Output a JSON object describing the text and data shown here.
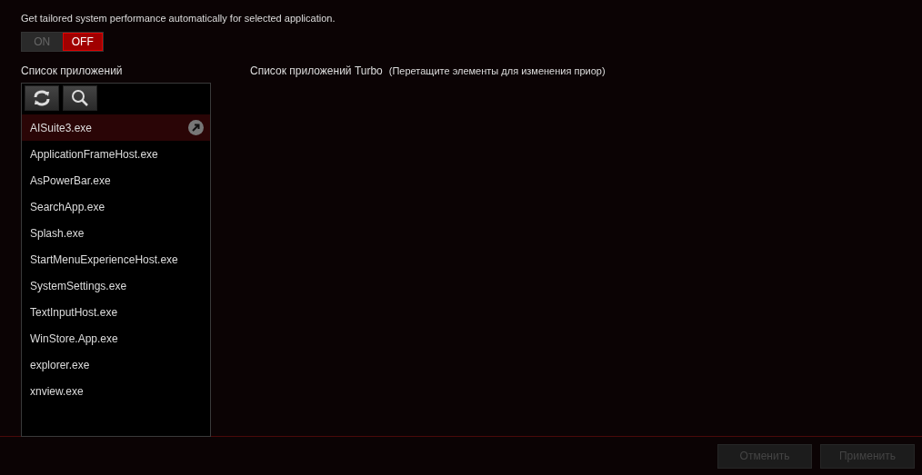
{
  "description": "Get tailored system performance automatically for selected application.",
  "toggle": [
    {
      "label": "ON",
      "selected": false
    },
    {
      "label": "OFF",
      "selected": true
    }
  ],
  "app_list": {
    "title": "Список приложений",
    "items": [
      {
        "name": "AISuite3.exe",
        "selected": true
      },
      {
        "name": "ApplicationFrameHost.exe",
        "selected": false
      },
      {
        "name": "AsPowerBar.exe",
        "selected": false
      },
      {
        "name": "SearchApp.exe",
        "selected": false
      },
      {
        "name": "Splash.exe",
        "selected": false
      },
      {
        "name": "StartMenuExperienceHost.exe",
        "selected": false
      },
      {
        "name": "SystemSettings.exe",
        "selected": false
      },
      {
        "name": "TextInputHost.exe",
        "selected": false
      },
      {
        "name": "WinStore.App.exe",
        "selected": false
      },
      {
        "name": "explorer.exe",
        "selected": false
      },
      {
        "name": "xnview.exe",
        "selected": false
      }
    ]
  },
  "turbo_list": {
    "title": "Список приложений Turbo",
    "hint": "(Перетащите элементы для изменения приор)"
  },
  "buttons": [
    {
      "label": "Отменить",
      "disabled": true
    },
    {
      "label": "Применить",
      "disabled": true
    }
  ]
}
